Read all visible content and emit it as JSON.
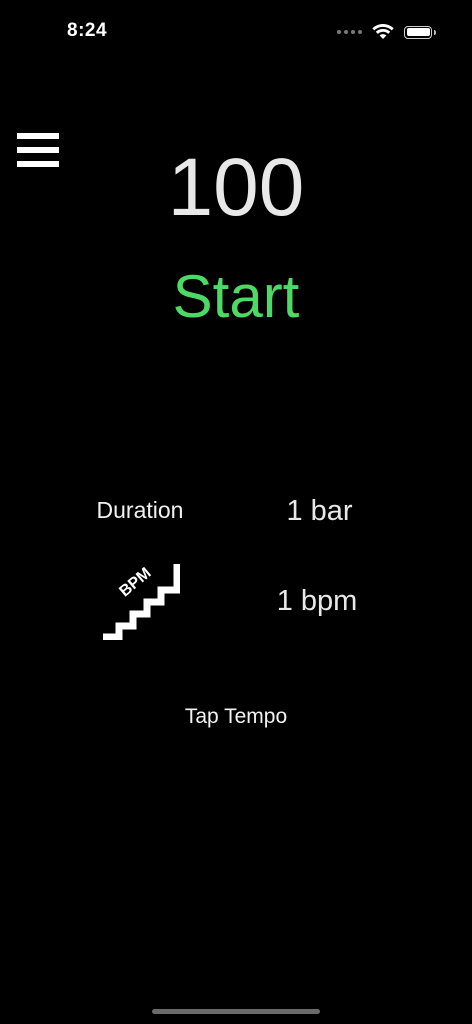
{
  "status_bar": {
    "time": "8:24"
  },
  "icons": {
    "menu": "hamburger-menu-icon",
    "step": "bpm-stairs-icon",
    "wifi": "wifi-icon",
    "battery": "battery-icon"
  },
  "metronome": {
    "tempo": "100",
    "start_label": "Start",
    "duration_label": "Duration",
    "duration_value": "1 bar",
    "step_badge": "BPM",
    "bpm_step_value": "1 bpm",
    "tap_tempo_label": "Tap Tempo"
  },
  "colors": {
    "background": "#000000",
    "start_accent": "#4cd964",
    "text": "#ffffff"
  }
}
